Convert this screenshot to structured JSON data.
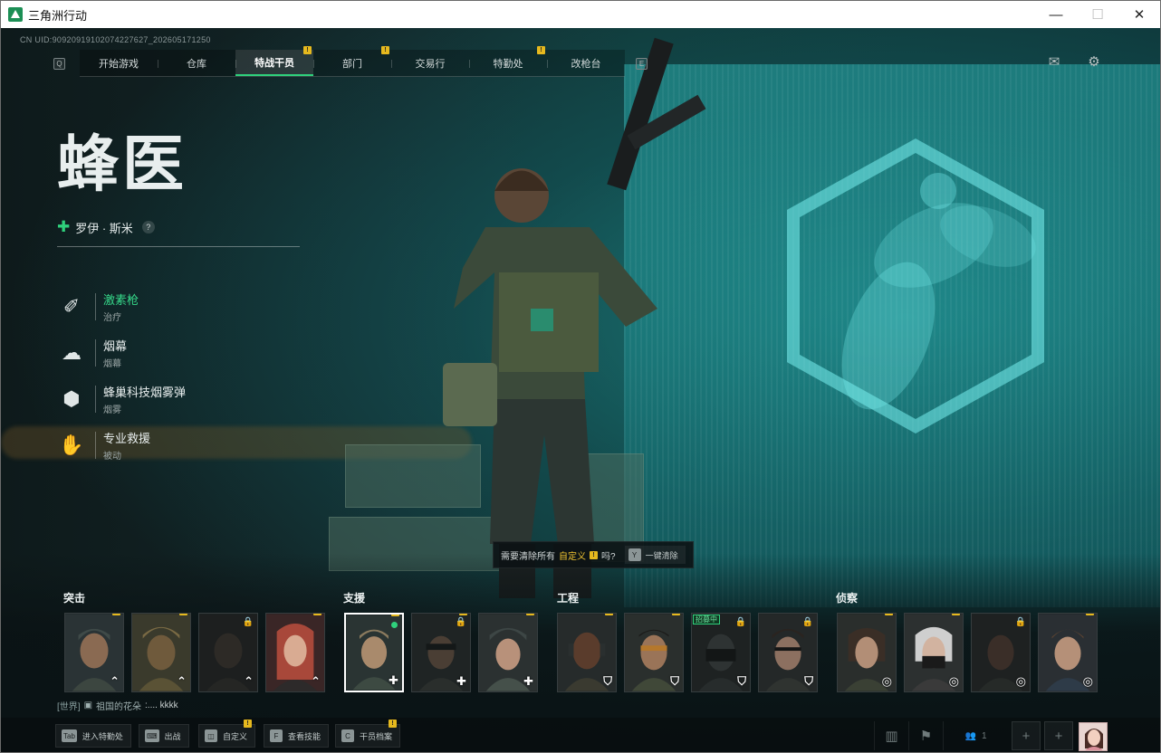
{
  "window": {
    "title": "三角洲行动",
    "controls": {
      "minimize": "—",
      "maximize": "☐",
      "close": "✕"
    }
  },
  "uid": "CN UID:90920919102074227627_202605171250",
  "nav": {
    "left_key": "Q",
    "right_key": "E",
    "tabs": [
      {
        "label": "开始游戏",
        "badge": "",
        "active": false
      },
      {
        "label": "仓库",
        "badge": "",
        "active": false
      },
      {
        "label": "特战干员",
        "badge": "!",
        "active": true
      },
      {
        "label": "部门",
        "badge": "!",
        "active": false
      },
      {
        "label": "交易行",
        "badge": "",
        "active": false
      },
      {
        "label": "特勤处",
        "badge": "!",
        "active": false
      },
      {
        "label": "改枪台",
        "badge": "",
        "active": false
      }
    ],
    "mail_icon": "mail-icon",
    "settings_icon": "gear-icon"
  },
  "operator": {
    "codename": "蜂医",
    "realname": "罗伊 · 斯米",
    "help": "?",
    "skills": [
      {
        "name": "激素枪",
        "type": "治疗",
        "icon": "syringe-gun-icon",
        "active": true
      },
      {
        "name": "烟幕",
        "type": "烟幕",
        "icon": "smoke-icon",
        "active": false
      },
      {
        "name": "蜂巢科技烟雾弹",
        "type": "烟雾",
        "icon": "smoke-grenade-icon",
        "active": false
      },
      {
        "name": "专业救援",
        "type": "被动",
        "icon": "rescue-icon",
        "active": false
      }
    ]
  },
  "clear_prompt": {
    "text_before": "需要清除所有",
    "highlight": "自定义",
    "text_after": "吗?",
    "key": "Y",
    "button": "一键清除"
  },
  "groups": [
    {
      "label": "突击",
      "operators": [
        {
          "id": "assault-1",
          "badge": "!",
          "locked": false,
          "role": "⌃",
          "recruit": ""
        },
        {
          "id": "assault-2",
          "badge": "!",
          "locked": false,
          "role": "⌃",
          "recruit": ""
        },
        {
          "id": "assault-3",
          "badge": "",
          "locked": true,
          "role": "⌃",
          "recruit": ""
        },
        {
          "id": "assault-4",
          "badge": "!",
          "locked": false,
          "role": "⌃",
          "recruit": ""
        }
      ]
    },
    {
      "label": "支援",
      "operators": [
        {
          "id": "support-1",
          "badge": "!",
          "locked": false,
          "role": "+",
          "recruit": "",
          "selected": true
        },
        {
          "id": "support-2",
          "badge": "!",
          "locked": true,
          "role": "+",
          "recruit": ""
        },
        {
          "id": "support-3",
          "badge": "!",
          "locked": false,
          "role": "+",
          "recruit": ""
        }
      ]
    },
    {
      "label": "工程",
      "operators": [
        {
          "id": "eng-1",
          "badge": "!",
          "locked": false,
          "role": "⛉",
          "recruit": ""
        },
        {
          "id": "eng-2",
          "badge": "!",
          "locked": false,
          "role": "⛉",
          "recruit": ""
        },
        {
          "id": "eng-3",
          "badge": "",
          "locked": true,
          "role": "⛉",
          "recruit": "招募中"
        },
        {
          "id": "eng-4",
          "badge": "",
          "locked": true,
          "role": "⛉",
          "recruit": ""
        }
      ]
    },
    {
      "label": "侦察",
      "operators": [
        {
          "id": "recon-1",
          "badge": "!",
          "locked": false,
          "role": "◎",
          "recruit": ""
        },
        {
          "id": "recon-2",
          "badge": "!",
          "locked": false,
          "role": "◎",
          "recruit": ""
        },
        {
          "id": "recon-3",
          "badge": "",
          "locked": true,
          "role": "◎",
          "recruit": ""
        },
        {
          "id": "recon-4",
          "badge": "!",
          "locked": false,
          "role": "◎",
          "recruit": ""
        }
      ]
    }
  ],
  "chat": {
    "channel": "[世界]",
    "name": "祖国的花朵",
    "message": ":.... kkkk"
  },
  "bottom": {
    "buttons": [
      {
        "key": "Tab",
        "label": "进入特勤处",
        "badge": ""
      },
      {
        "key": "⌨",
        "label": "出战",
        "badge": ""
      },
      {
        "key": "◫",
        "label": "自定义",
        "badge": "!"
      },
      {
        "key": "F",
        "label": "查看技能",
        "badge": ""
      },
      {
        "key": "C",
        "label": "干员档案",
        "badge": "!"
      }
    ],
    "squad_count": "1"
  },
  "colors": {
    "accent": "#2fd17c",
    "badge": "#e6b91e",
    "hologram": "#2ec4c4"
  }
}
